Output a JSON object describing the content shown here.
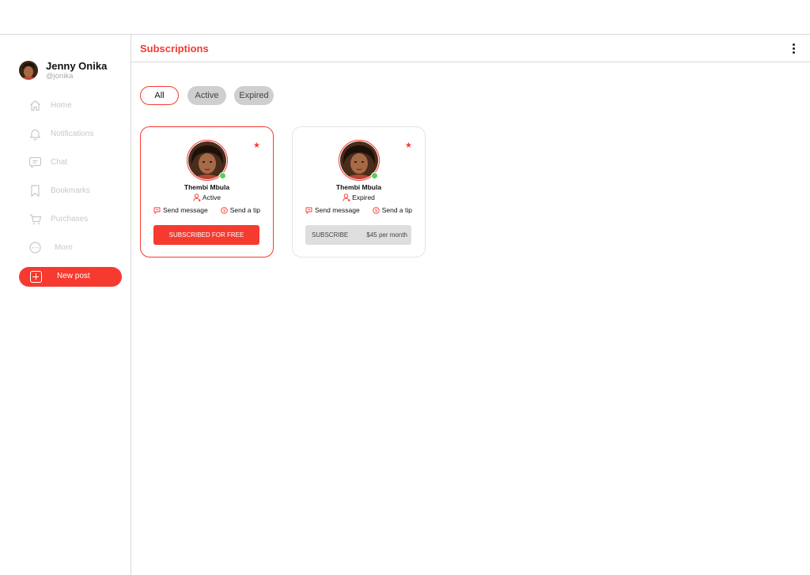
{
  "colors": {
    "accent": "#f63a2f",
    "online": "#5ad05a",
    "muted": "#c8c8c8",
    "chip_bg": "#cfcfcf"
  },
  "user": {
    "name": "Jenny Onika",
    "handle": "@jonika"
  },
  "sidebar": {
    "items": [
      {
        "label": "Home",
        "icon": "home-icon"
      },
      {
        "label": "Notifications",
        "icon": "bell-icon"
      },
      {
        "label": "Chat",
        "icon": "chat-icon"
      },
      {
        "label": "Bookmarks",
        "icon": "bookmark-icon"
      },
      {
        "label": "Purchases",
        "icon": "cart-icon"
      },
      {
        "label": "More",
        "icon": "more-icon"
      }
    ],
    "new_post_label": "New post"
  },
  "header": {
    "title": "Subscriptions"
  },
  "filters": {
    "all": "All",
    "active": "Active",
    "expired": "Expired",
    "selected": "All"
  },
  "cards": [
    {
      "name": "Thembi Mbula",
      "status": "Active",
      "send_message": "Send message",
      "send_tip": "Send a tip",
      "button_label": "SUBSCRIBED FOR FREE"
    },
    {
      "name": "Thembi Mbula",
      "status": "Expired",
      "send_message": "Send message",
      "send_tip": "Send a tip",
      "button_label": "SUBSCRIBE",
      "price": "$45 per month"
    }
  ]
}
